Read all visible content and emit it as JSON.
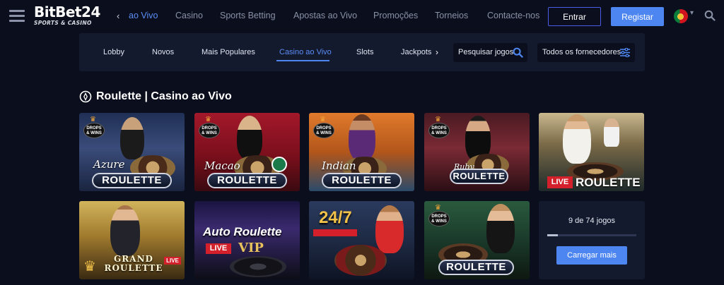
{
  "header": {
    "logo_main": "BitBet",
    "logo_accent": "24",
    "logo_sub": "SPORTS & CASINO",
    "back_arrow": "‹",
    "nav": [
      {
        "label": "ao Vivo",
        "active": true
      },
      {
        "label": "Casino",
        "active": false
      },
      {
        "label": "Sports Betting",
        "active": false
      },
      {
        "label": "Apostas ao Vivo",
        "active": false
      },
      {
        "label": "Promoções",
        "active": false
      },
      {
        "label": "Torneios",
        "active": false
      },
      {
        "label": "Contacte-nos",
        "active": false
      }
    ],
    "login_label": "Entrar",
    "register_label": "Registar",
    "language_icon": "portugal-flag-icon",
    "search_icon": "search-icon"
  },
  "categories": {
    "items": [
      {
        "label": "Lobby",
        "active": false
      },
      {
        "label": "Novos",
        "active": false
      },
      {
        "label": "Mais Populares",
        "active": false
      },
      {
        "label": "Casino ao Vivo",
        "active": true
      },
      {
        "label": "Slots",
        "active": false
      },
      {
        "label": "Jackpots",
        "active": false
      }
    ],
    "next_arrow": "›",
    "search_label": "Pesquisar jogos",
    "providers_label": "Todos os fornecedores"
  },
  "section": {
    "title": "Roulette | Casino ao Vivo"
  },
  "games": [
    {
      "name": "Azure Roulette",
      "script": "Azure",
      "plaque": "ROULETTE",
      "badge": true
    },
    {
      "name": "Macao Roulette",
      "script": "Macao",
      "plaque": "ROULETTE",
      "badge": true
    },
    {
      "name": "Indian Roulette",
      "script": "Indian",
      "plaque": "ROULETTE",
      "badge": true
    },
    {
      "name": "Ruby Roulette",
      "script": "Ruby",
      "plaque": "ROULETTE",
      "badge": true
    },
    {
      "name": "Live Roulette",
      "script": "",
      "plaque": "ROULETTE",
      "live": "LIVE",
      "badge": false
    },
    {
      "name": "Grand Roulette",
      "script": "",
      "plaque": "GRAND ROULETTE",
      "live": "LIVE",
      "badge": false
    },
    {
      "name": "Auto Roulette VIP",
      "script": "",
      "plaque": "Auto Roulette",
      "live": "LIVE",
      "extra": "VIP",
      "badge": false
    },
    {
      "name": "24/7 Roulette",
      "script": "",
      "plaque": "24/7",
      "badge": false
    },
    {
      "name": "Roulette",
      "script": "",
      "plaque": "ROULETTE",
      "badge": true
    }
  ],
  "badge": {
    "line1": "DROPS",
    "line2": "& WINS"
  },
  "load_more": {
    "count_text": "9 de 74 jogos",
    "progress": 0.12,
    "button_label": "Carregar mais"
  },
  "colors": {
    "background": "#0b0f1d",
    "panel": "#131a2e",
    "accent": "#4d86f0"
  }
}
